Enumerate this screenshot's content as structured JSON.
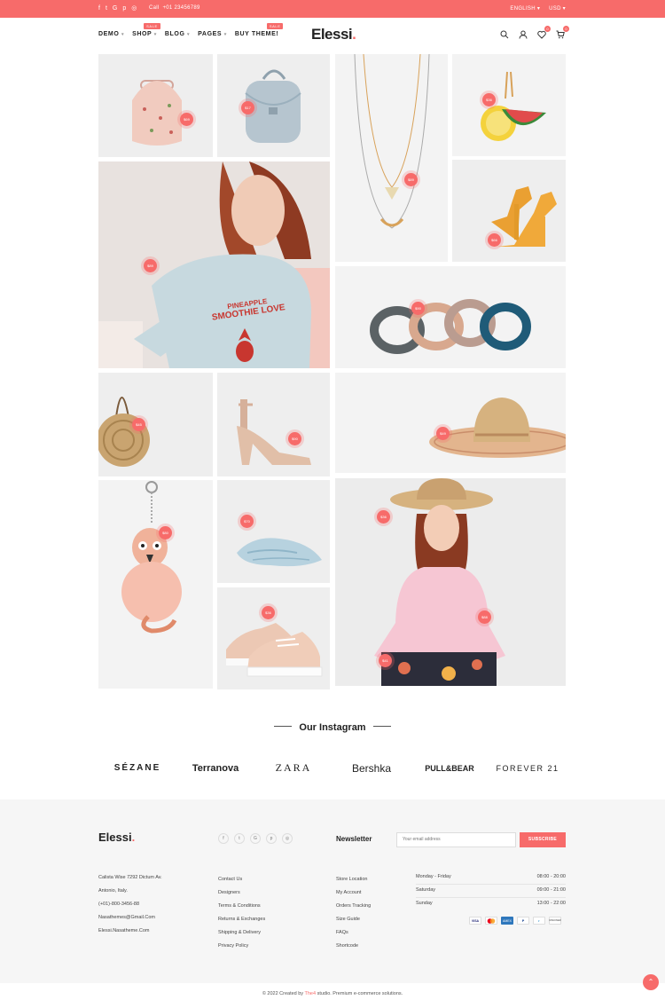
{
  "topbar": {
    "call_label": "Call",
    "phone": "+01 23456789",
    "language": "ENGLISH",
    "currency": "USD"
  },
  "nav": {
    "items": [
      {
        "label": "DEMO"
      },
      {
        "label": "SHOP",
        "badge": "SALE"
      },
      {
        "label": "BLOG"
      },
      {
        "label": "PAGES"
      },
      {
        "label": "BUY THEME!",
        "badge": "SALE"
      }
    ]
  },
  "logo": {
    "text": "Elessi",
    "dot": "."
  },
  "header_counts": {
    "wishlist": "0",
    "cart": "0"
  },
  "tiles": {
    "t1": "$69",
    "t2": "$17",
    "t3": "$89",
    "t4": "$36",
    "t5": "$89",
    "t6": "$66",
    "t7": "$90",
    "t8": "$45",
    "t9": "$90",
    "t10": "$49",
    "t11": "$80",
    "t12": "$70",
    "t13": "$36",
    "t14": "$36",
    "t15": "$88",
    "t16": "$41",
    "shirt_line1": "PINEAPPLE",
    "shirt_line2": "SMOOTHIE LOVE"
  },
  "instagram": {
    "title": "Our Instagram"
  },
  "brands": [
    "SÉZANE",
    "Terranova",
    "ZARA",
    "Bershka",
    "PULL&BEAR",
    "FOREVER 21"
  ],
  "footer": {
    "logo": "Elessi",
    "address": [
      "Calista Wise 7292 Dictum Av.",
      "Antonio, Italy.",
      "(+01)-800-3456-88",
      "Nasathemes@Gmail.Com",
      "Elessi.Nasatheme.Com"
    ],
    "col2": [
      "Contact Us",
      "Designers",
      "Terms & Conditions",
      "Returns & Exchanges",
      "Shipping & Delivery",
      "Privacy Policy"
    ],
    "col3": [
      "Store Location",
      "My Account",
      "Orders Tracking",
      "Size Guide",
      "FAQs",
      "Shortcode"
    ],
    "hours": [
      {
        "day": "Monday - Friday",
        "time": "08:00 - 20:00"
      },
      {
        "day": "Saturday",
        "time": "09:00 - 21:00"
      },
      {
        "day": "Sunday",
        "time": "13:00 - 22:00"
      }
    ],
    "newsletter_title": "Newsletter",
    "newsletter_placeholder": "Your email address",
    "subscribe": "SUBSCRIBE",
    "payments": [
      "VISA",
      "MC",
      "AMEX",
      "PayPal",
      "Diners",
      "DISCOVER"
    ]
  },
  "copyright": {
    "prefix": "© 2022 Created by",
    "brand": "The4",
    "suffix": "studio. Premium e-commerce solutions."
  },
  "colors": {
    "accent": "#f76b6a",
    "tile_bg": "#eeeeee",
    "footer_bg": "#f6f6f6"
  }
}
